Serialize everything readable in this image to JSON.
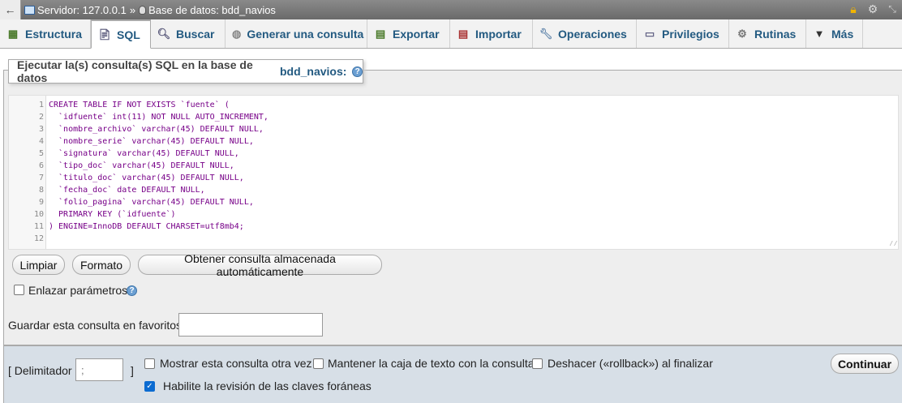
{
  "breadcrumb": {
    "server": "Servidor: 127.0.0.1",
    "separator": "»",
    "database": "Base de datos: bdd_navios"
  },
  "tabs": [
    {
      "label": "Estructura",
      "icon": "structure-icon"
    },
    {
      "label": "SQL",
      "icon": "sql-icon"
    },
    {
      "label": "Buscar",
      "icon": "search-icon"
    },
    {
      "label": "Generar una consulta",
      "icon": "query-icon"
    },
    {
      "label": "Exportar",
      "icon": "export-icon"
    },
    {
      "label": "Importar",
      "icon": "import-icon"
    },
    {
      "label": "Operaciones",
      "icon": "wrench-icon"
    },
    {
      "label": "Privilegios",
      "icon": "privileges-icon"
    },
    {
      "label": "Rutinas",
      "icon": "routines-icon"
    },
    {
      "label": "Más",
      "icon": "chevron-down-icon"
    }
  ],
  "panel": {
    "legend_text": "Ejecutar la(s) consulta(s) SQL en la base de datos",
    "database_name": "bdd_navios:"
  },
  "editor": {
    "line_numbers": [
      "1",
      "2",
      "3",
      "4",
      "5",
      "6",
      "7",
      "8",
      "9",
      "10",
      "11",
      "12"
    ],
    "lines": [
      "CREATE TABLE IF NOT EXISTS `fuente` (",
      "  `idfuente` int(11) NOT NULL AUTO_INCREMENT,",
      "  `nombre_archivo` varchar(45) DEFAULT NULL,",
      "  `nombre_serie` varchar(45) DEFAULT NULL,",
      "  `signatura` varchar(45) DEFAULT NULL,",
      "  `tipo_doc` varchar(45) DEFAULT NULL,",
      "  `titulo_doc` varchar(45) DEFAULT NULL,",
      "  `fecha_doc` date DEFAULT NULL,",
      "  `folio_pagina` varchar(45) DEFAULT NULL,",
      "  PRIMARY KEY (`idfuente`)",
      ") ENGINE=InnoDB DEFAULT CHARSET=utf8mb4;",
      ""
    ]
  },
  "buttons": {
    "clear": "Limpiar",
    "format": "Formato",
    "get_autosaved": "Obtener consulta almacenada automáticamente",
    "continue": "Continuar"
  },
  "options": {
    "bind_params": "Enlazar parámetros",
    "save_favorite_label": "Guardar esta consulta en favoritos:",
    "delimiter_open": "[ Delimitador",
    "delimiter_value": ";",
    "delimiter_close": "]",
    "show_again": "Mostrar esta consulta otra vez",
    "keep_textbox": "Mantener la caja de texto con la consulta",
    "rollback": "Deshacer («rollback») al finalizar",
    "fk_checks": "Habilite la revisión de las claves foráneas"
  }
}
